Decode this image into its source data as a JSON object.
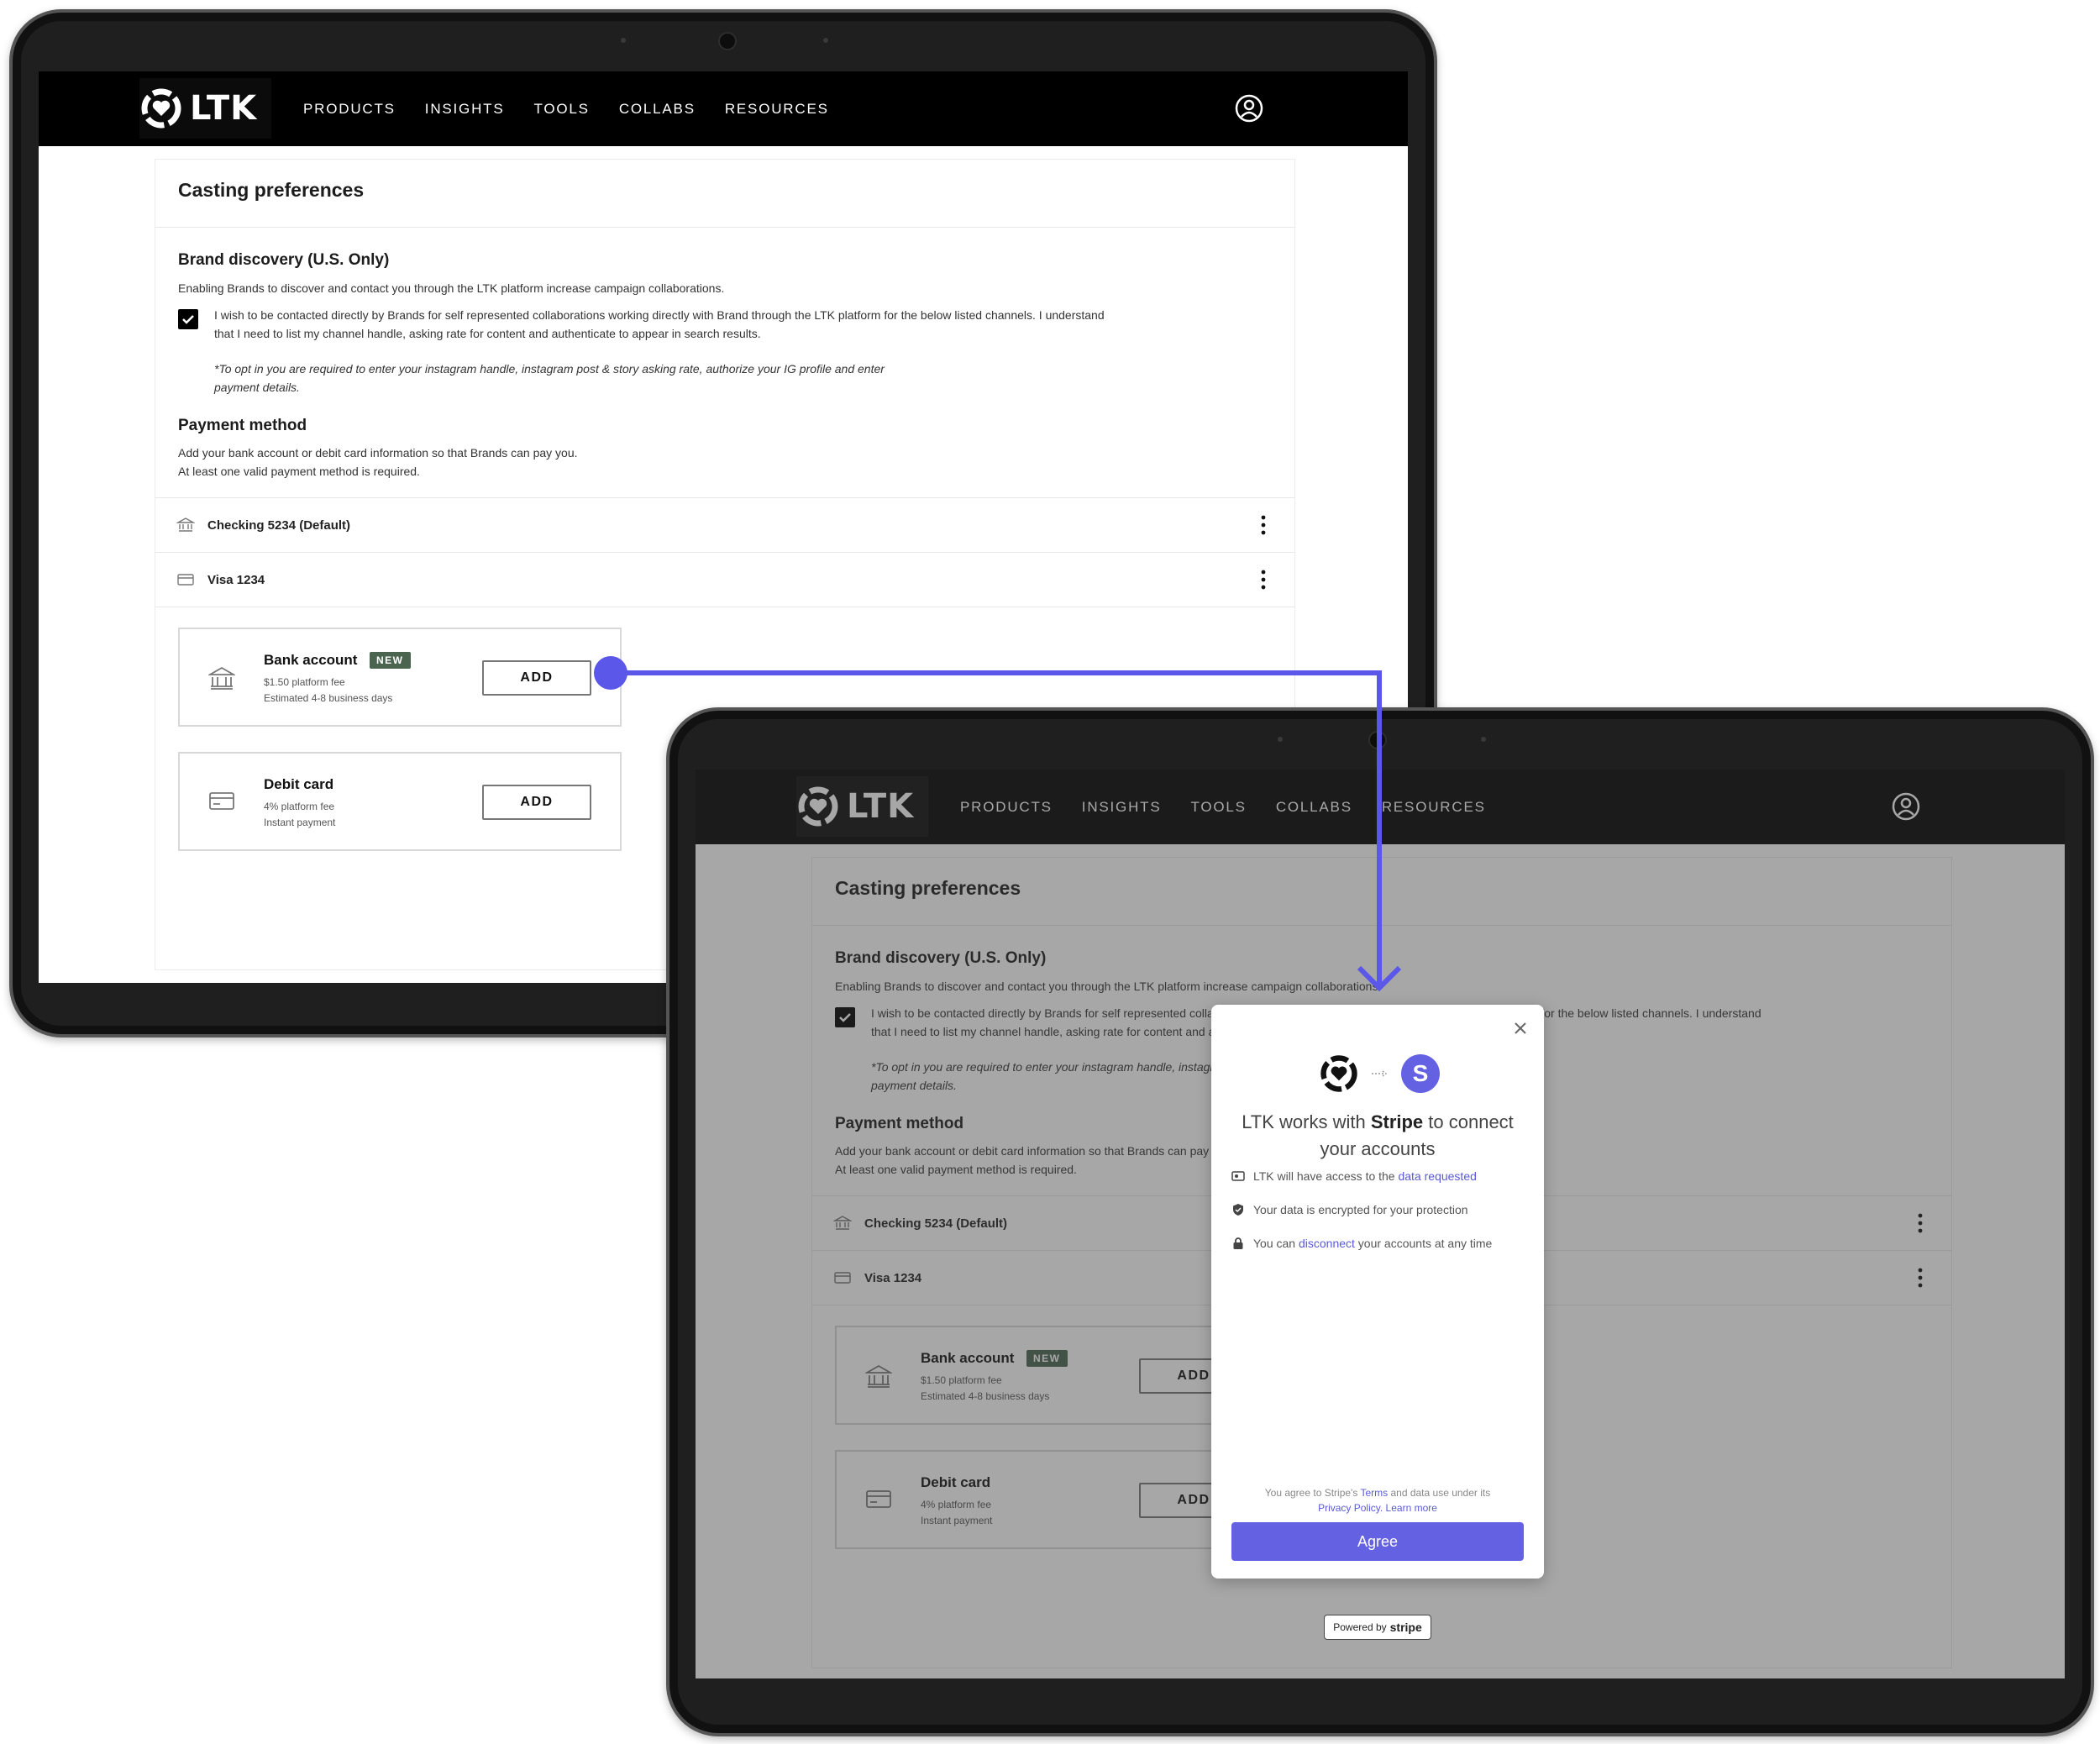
{
  "nav": {
    "logo_text": "LTK",
    "items": [
      "PRODUCTS",
      "INSIGHTS",
      "TOOLS",
      "COLLABS",
      "RESOURCES"
    ]
  },
  "page": {
    "title": "Casting preferences",
    "brand_discovery": {
      "title": "Brand discovery (U.S. Only)",
      "description": "Enabling Brands to discover and contact you through the LTK platform increase campaign collaborations.",
      "consent_line1": "I wish to be contacted directly by Brands for self represented collaborations working directly with Brand through the LTK platform for the below listed channels. I understand",
      "consent_line2": "that I need to list my channel handle, asking rate for content and authenticate to appear in search results.",
      "note_line1": "*To opt in you are required to enter your instagram handle, instagram post & story asking rate, authorize your IG profile and enter",
      "note_line2": "payment details."
    },
    "payment": {
      "title": "Payment method",
      "desc_line1": "Add your bank account or debit card information so that Brands can pay you.",
      "desc_line2": "At least one valid payment method is required.",
      "methods": [
        {
          "label": "Checking 5234 (Default)",
          "icon": "bank-icon"
        },
        {
          "label": "Visa 1234",
          "icon": "card-icon"
        }
      ],
      "options": [
        {
          "title": "Bank account",
          "badge": "NEW",
          "fee": "$1.50 platform fee",
          "speed": "Estimated 4-8 business days",
          "button": "ADD",
          "icon": "bank-icon"
        },
        {
          "title": "Debit card",
          "badge": "",
          "fee": "4% platform fee",
          "speed": "Instant payment",
          "button": "ADD",
          "icon": "card-icon"
        }
      ]
    }
  },
  "modal": {
    "heading_pre": "LTK works with ",
    "heading_brand": "Stripe",
    "heading_post": " to connect your accounts",
    "stripe_letter": "S",
    "bullets": {
      "b1_pre": "LTK will have access to the ",
      "b1_link": "data requested",
      "b2": "Your data is encrypted for your protection",
      "b3_pre": "You can ",
      "b3_link": "disconnect",
      "b3_post": " your accounts at any time"
    },
    "legal_pre": "You agree to Stripe's ",
    "legal_terms": "Terms",
    "legal_mid": " and data use under its",
    "legal_privacy": "Privacy Policy",
    "legal_learn": "Learn more",
    "agree": "Agree",
    "powered_pre": "Powered by",
    "powered_brand": "stripe"
  },
  "colors": {
    "accent": "#6461e2",
    "connector": "#5b57e8",
    "badge": "#4a6450"
  }
}
